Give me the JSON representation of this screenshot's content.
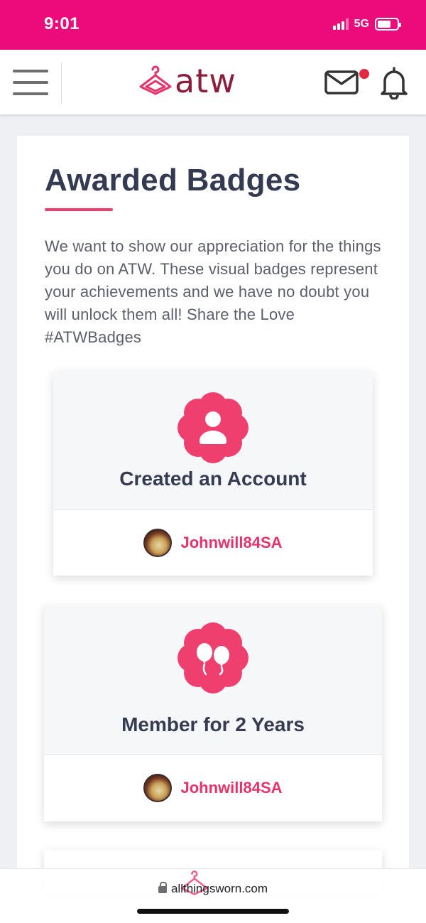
{
  "status_bar": {
    "time": "9:01",
    "network": "5G",
    "icons": [
      "signal-icon",
      "battery-icon"
    ]
  },
  "header": {
    "logo_text": "atw",
    "icons": [
      "menu-icon",
      "hanger-logo-icon",
      "mail-icon",
      "bell-icon"
    ],
    "mail_has_notification": true
  },
  "page": {
    "title": "Awarded Badges",
    "intro": "We want to show our appreciation for the things you do on ATW. These visual badges represent your achievements and we have no doubt you will unlock them all! Share the Love #ATWBadges"
  },
  "badges": [
    {
      "title": "Created an Account",
      "icon": "user-badge-icon",
      "username": "Johnwill84SA"
    },
    {
      "title": "Member for 2 Years",
      "icon": "balloons-badge-icon",
      "username": "Johnwill84SA"
    }
  ],
  "browser": {
    "url": "allthingsworn.com"
  },
  "colors": {
    "status_bar": "#ec0b7a",
    "accent": "#ef3f6e",
    "username": "#e6336a",
    "title": "#343a52"
  }
}
